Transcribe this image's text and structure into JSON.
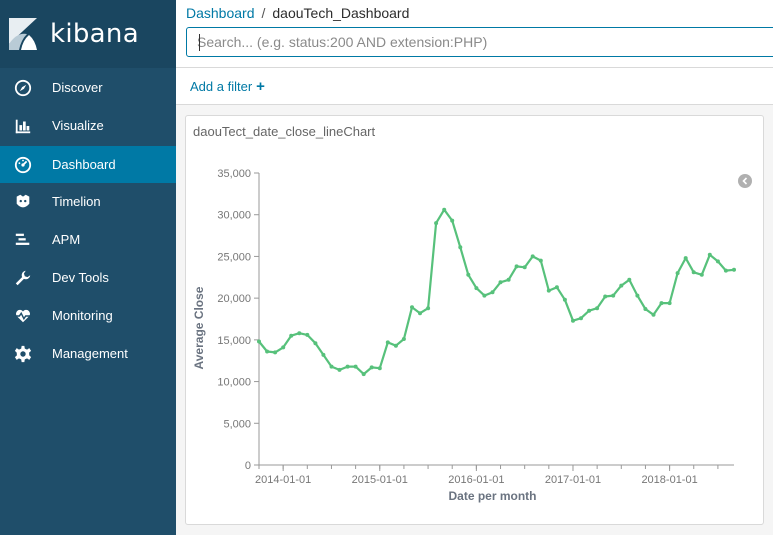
{
  "app": {
    "name": "kibana"
  },
  "sidebar": {
    "items": [
      {
        "label": "Discover",
        "icon": "compass-icon",
        "active": false
      },
      {
        "label": "Visualize",
        "icon": "bar-chart-icon",
        "active": false
      },
      {
        "label": "Dashboard",
        "icon": "dashboard-icon",
        "active": true
      },
      {
        "label": "Timelion",
        "icon": "timelion-icon",
        "active": false
      },
      {
        "label": "APM",
        "icon": "apm-icon",
        "active": false
      },
      {
        "label": "Dev Tools",
        "icon": "wrench-icon",
        "active": false
      },
      {
        "label": "Monitoring",
        "icon": "heartbeat-icon",
        "active": false
      },
      {
        "label": "Management",
        "icon": "gear-icon",
        "active": false
      }
    ]
  },
  "breadcrumb": {
    "parent": "Dashboard",
    "separator": "/",
    "current": "daouTech_Dashboard"
  },
  "search": {
    "placeholder": "Search... (e.g. status:200 AND extension:PHP)",
    "value": ""
  },
  "filter": {
    "add_label": "Add a filter",
    "add_icon": "plus-icon"
  },
  "panel": {
    "title": "daouTect_date_close_lineChart"
  },
  "colors": {
    "sidebar": "#1f4e6a",
    "active": "#0079a5",
    "line": "#57c17b"
  },
  "chart_data": {
    "type": "line",
    "xlabel": "Date per month",
    "ylabel": "Average Close",
    "ylim": [
      0,
      35000
    ],
    "yticks": [
      "0",
      "5,000",
      "10,000",
      "15,000",
      "20,000",
      "25,000",
      "30,000",
      "35,000"
    ],
    "xticks": [
      "2014-01-01",
      "2015-01-01",
      "2016-01-01",
      "2017-01-01",
      "2018-01-01"
    ],
    "x_start": "2013-10-01",
    "x_end": "2018-09-01",
    "grid": false,
    "series": [
      {
        "values": [
          14800,
          13600,
          13500,
          14100,
          15500,
          15800,
          15600,
          14600,
          13200,
          11800,
          11400,
          11800,
          11800,
          10900,
          11700,
          11600,
          14700,
          14300,
          15100,
          18900,
          18200,
          18800,
          29000,
          30600,
          29300,
          26100,
          22800,
          21200,
          20300,
          20700,
          21900,
          22200,
          23800,
          23700,
          25000,
          24500,
          20900,
          21300,
          19800,
          17300,
          17600,
          18500,
          18800,
          20200,
          20300,
          21500,
          22200,
          20300,
          18700,
          18000,
          19400,
          19400,
          23000,
          24800,
          23100,
          22800,
          25200,
          24400,
          23300,
          23400
        ]
      }
    ]
  }
}
